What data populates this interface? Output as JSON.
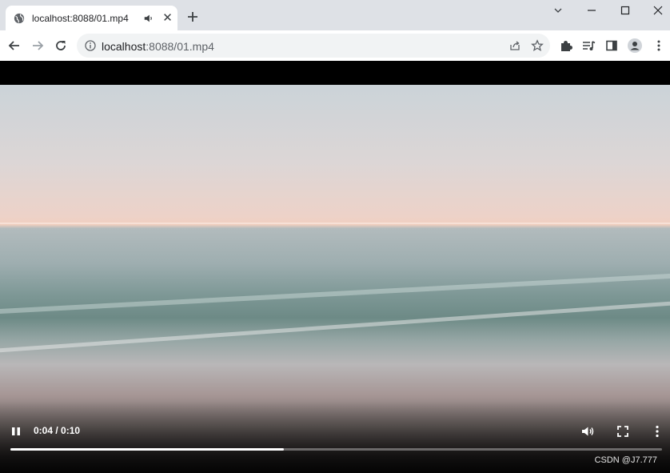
{
  "tab": {
    "title": "localhost:8088/01.mp4",
    "favicon": "globe-icon",
    "audio": "speaker-icon",
    "close_glyph": "✕"
  },
  "window_controls": [
    "chevron-down-icon",
    "minimize-icon",
    "maximize-icon",
    "close-icon"
  ],
  "nav": [
    "back-icon",
    "forward-icon",
    "reload-icon"
  ],
  "address": {
    "host": "localhost",
    "rest": ":8088/01.mp4",
    "info_icon": "info-icon"
  },
  "toolbar_icons": [
    "share-icon",
    "star-icon",
    "puzzle-icon",
    "media-queue-icon",
    "side-panel-icon",
    "profile-icon",
    "kebab-menu-icon"
  ],
  "video": {
    "time": "0:04 / 0:10",
    "progress": 0.42,
    "watermark": "CSDN @J7.777"
  },
  "colors": {
    "chrome_bg": "#dee1e6",
    "tab_bg": "#ffffff",
    "omnibox_bg": "#f1f3f4",
    "video_bg": "#000000"
  }
}
